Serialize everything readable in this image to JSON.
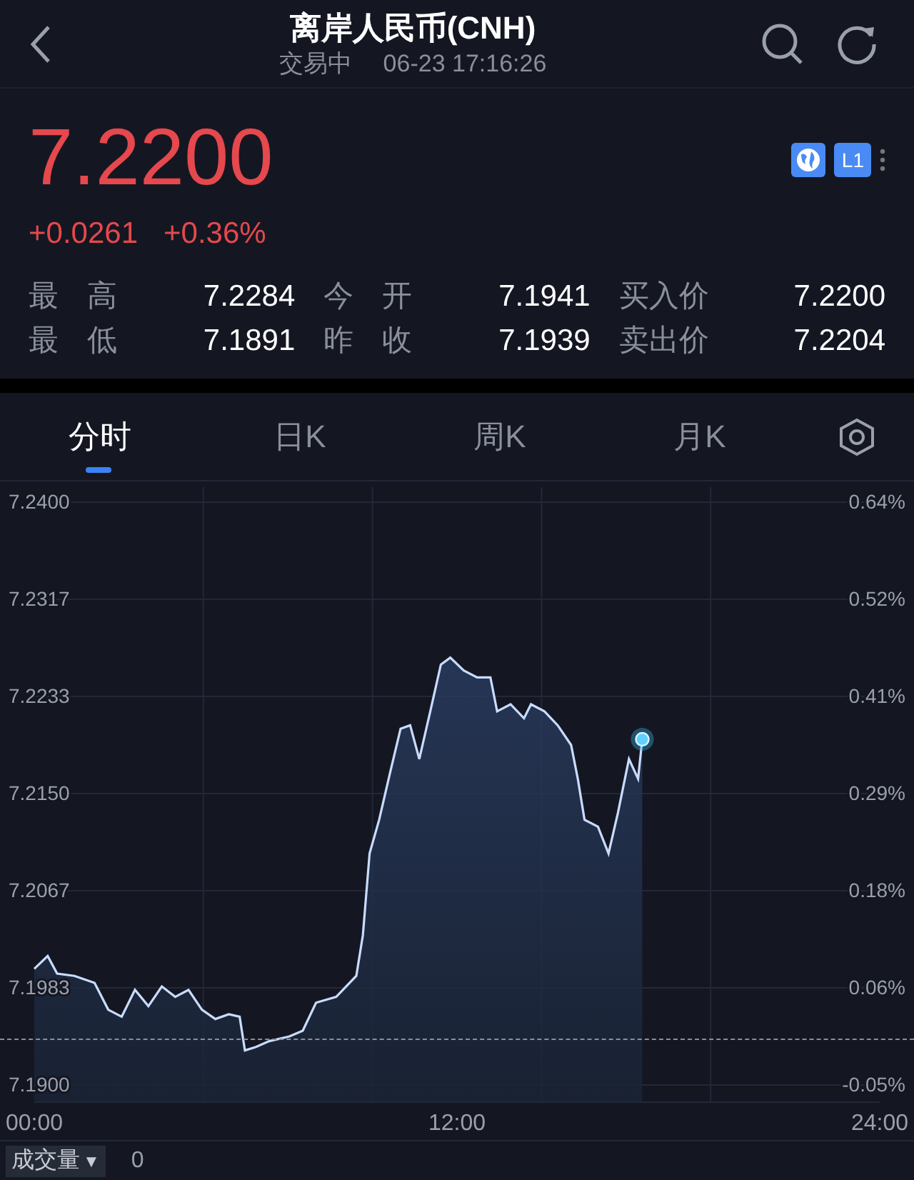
{
  "header": {
    "title": "离岸人民币(CNH)",
    "status": "交易中",
    "datetime": "06-23 17:16:26"
  },
  "quote": {
    "price": "7.2200",
    "change": "+0.0261",
    "change_percent": "+0.36%",
    "badges": [
      {
        "kind": "globe"
      },
      {
        "kind": "text",
        "label": "L1"
      }
    ],
    "stats": [
      {
        "label": "最高",
        "value": "7.2284"
      },
      {
        "label": "今开",
        "value": "7.1941"
      },
      {
        "label": "买入价",
        "value": "7.2200"
      },
      {
        "label": "最低",
        "value": "7.1891"
      },
      {
        "label": "昨收",
        "value": "7.1939"
      },
      {
        "label": "卖出价",
        "value": "7.2204"
      }
    ]
  },
  "tabs": [
    {
      "label": "分时",
      "selected": true
    },
    {
      "label": "日K",
      "selected": false
    },
    {
      "label": "周K",
      "selected": false
    },
    {
      "label": "月K",
      "selected": false
    }
  ],
  "chart": {
    "right_labels": [
      "0.64%",
      "0.52%",
      "0.41%",
      "0.29%",
      "0.18%",
      "0.06%",
      "-0.05%"
    ],
    "chart_data": {
      "type": "area",
      "x": [
        0,
        0.38,
        0.65,
        1.14,
        1.71,
        2.1,
        2.48,
        2.86,
        3.24,
        3.62,
        4,
        4.38,
        4.76,
        5.14,
        5.52,
        5.83,
        5.98,
        6.29,
        6.67,
        7.24,
        7.62,
        8,
        8.57,
        9.14,
        9.33,
        9.52,
        9.79,
        10.1,
        10.4,
        10.67,
        10.93,
        11.24,
        11.54,
        11.81,
        12.19,
        12.57,
        12.95,
        13.14,
        13.52,
        13.9,
        14.1,
        14.48,
        14.86,
        15.24,
        15.43,
        15.62,
        16,
        16.3,
        16.57,
        16.88,
        17.14,
        17.26
      ],
      "series": [
        {
          "color": "#c9dcff",
          "values": [
            7.1999,
            7.201,
            7.1995,
            7.1993,
            7.1987,
            7.1964,
            7.1958,
            7.1981,
            7.1967,
            7.1984,
            7.1975,
            7.1981,
            7.1964,
            7.1956,
            7.196,
            7.1958,
            7.1929,
            7.1932,
            7.1937,
            7.1941,
            7.1946,
            7.197,
            7.1975,
            7.1993,
            7.2028,
            7.2098,
            7.2127,
            7.2167,
            7.2205,
            7.2208,
            7.2179,
            7.222,
            7.226,
            7.2266,
            7.2255,
            7.2249,
            7.2249,
            7.222,
            7.2226,
            7.2214,
            7.2226,
            7.222,
            7.2208,
            7.2191,
            7.2162,
            7.2127,
            7.2121,
            7.2098,
            7.2133,
            7.2179,
            7.2162,
            7.2196
          ]
        }
      ],
      "xlim": [
        0,
        24
      ],
      "ylim": [
        7.19,
        7.24
      ],
      "xticks": [
        {
          "value": 0,
          "label": "00:00"
        },
        {
          "value": 12,
          "label": "12:00"
        },
        {
          "value": 24,
          "label": "24:00"
        }
      ],
      "yticks": [
        {
          "value": 7.24,
          "label": "7.2400"
        },
        {
          "value": 7.23167,
          "label": "7.2317"
        },
        {
          "value": 7.22333,
          "label": "7.2233"
        },
        {
          "value": 7.215,
          "label": "7.2150"
        },
        {
          "value": 7.20667,
          "label": "7.2067"
        },
        {
          "value": 7.19833,
          "label": "7.1983"
        },
        {
          "value": 7.19,
          "label": "7.1900"
        }
      ],
      "grid": true
    }
  },
  "volume": {
    "label": "成交量",
    "caret": "▼",
    "value": "0"
  }
}
